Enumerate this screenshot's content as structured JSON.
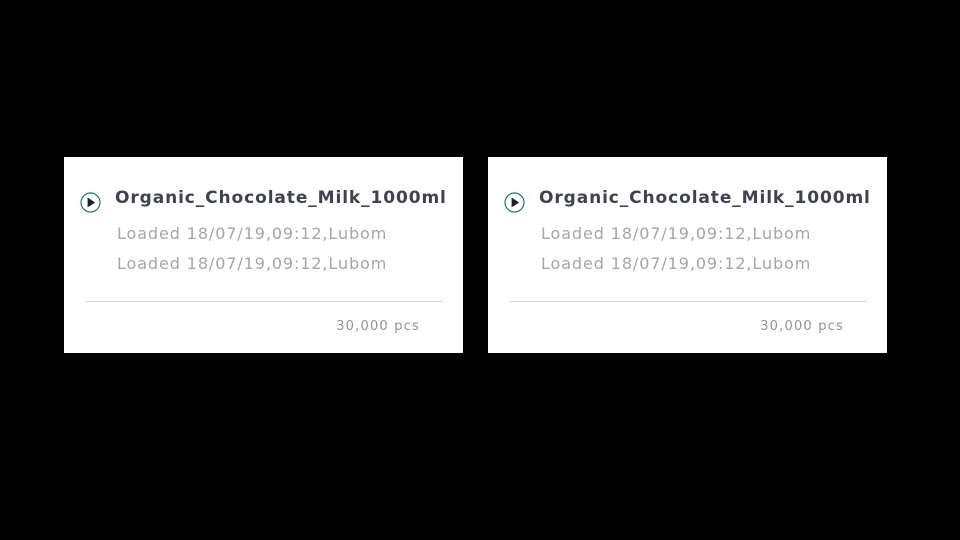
{
  "cards": [
    {
      "icon": "play-circle-icon",
      "title": "Organic_Chocolate_Milk_1000ml",
      "lines": [
        "Loaded 18/07/19,09:12,Lubom",
        "Loaded 18/07/19,09:12,Lubom"
      ],
      "quantity": "30,000 pcs"
    },
    {
      "icon": "play-circle-icon",
      "title": "Organic_Chocolate_Milk_1000ml",
      "lines": [
        "Loaded 18/07/19,09:12,Lubom",
        "Loaded 18/07/19,09:12,Lubom"
      ],
      "quantity": "30,000 pcs"
    }
  ],
  "colors": {
    "background": "#000000",
    "card": "#ffffff",
    "accent": "#1f7a5c",
    "title": "#3d4350",
    "secondary_text": "#a3a6aa"
  }
}
